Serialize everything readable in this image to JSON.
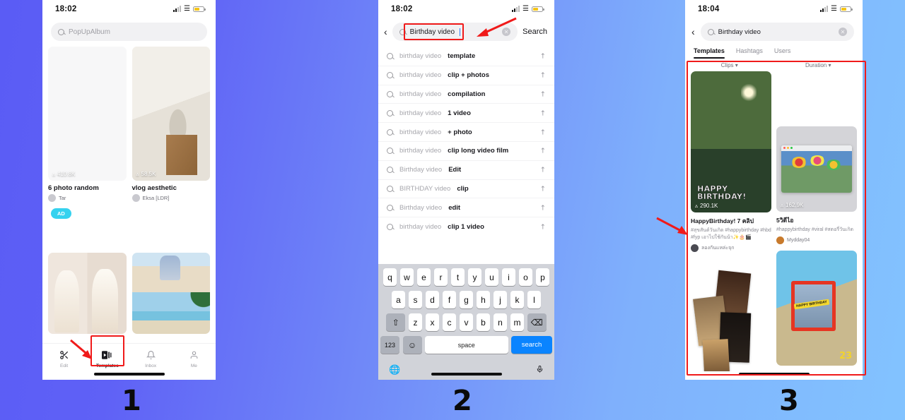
{
  "background": {
    "from": "#5a5cf5",
    "to": "#82c3ff"
  },
  "accent_red": "#f01a1a",
  "steps": {
    "one": "1",
    "two": "2",
    "three": "3"
  },
  "panel1": {
    "status": {
      "time": "18:02"
    },
    "search": {
      "placeholder": "PopUpAlbum"
    },
    "cards": [
      {
        "title": "6 photo random",
        "user": "Tar",
        "plays": "410.8K"
      },
      {
        "title": "vlog aesthetic",
        "user": "Eksa [LDR]",
        "plays": "58.5K"
      }
    ],
    "ad_label": "AD",
    "tabs": [
      {
        "label": "Edit",
        "icon": "scissors-icon",
        "active": false
      },
      {
        "label": "Templates",
        "icon": "templates-icon",
        "active": true
      },
      {
        "label": "Inbox",
        "icon": "bell-icon",
        "active": false
      },
      {
        "label": "Me",
        "icon": "person-icon",
        "active": false
      }
    ]
  },
  "panel2": {
    "status": {
      "time": "18:02"
    },
    "search": {
      "value": "Birthday video",
      "button": "Search",
      "clear_icon": "clear-circle-icon",
      "back_icon": "back-chevron-icon"
    },
    "suggestions": [
      {
        "prefix": "birthday video ",
        "bold": "template"
      },
      {
        "prefix": "birthday video ",
        "bold": "clip + photos"
      },
      {
        "prefix": "birthday video ",
        "bold": "compilation"
      },
      {
        "prefix": "birthday video ",
        "bold": "1 video"
      },
      {
        "prefix": "birthday video ",
        "bold": "+ photo"
      },
      {
        "prefix": "birthday video ",
        "bold": "clip long video film"
      },
      {
        "prefix": "Birthday video ",
        "bold": "Edit"
      },
      {
        "prefix": "BIRTHDAY video ",
        "bold": "clip"
      },
      {
        "prefix": "Birthday video ",
        "bold": "edit"
      },
      {
        "prefix": "birthday video ",
        "bold": "clip 1 video"
      }
    ],
    "keyboard": {
      "row1": [
        "q",
        "w",
        "e",
        "r",
        "t",
        "y",
        "u",
        "i",
        "o",
        "p"
      ],
      "row2": [
        "a",
        "s",
        "d",
        "f",
        "g",
        "h",
        "j",
        "k",
        "l"
      ],
      "row3": [
        "z",
        "x",
        "c",
        "v",
        "b",
        "n",
        "m"
      ],
      "shift": "⇧",
      "backspace": "⌫",
      "numbers": "123",
      "emoji": "☺",
      "space": "space",
      "go": "search",
      "globe": "🌐",
      "mic": "mic-icon"
    }
  },
  "panel3": {
    "status": {
      "time": "18:04"
    },
    "search": {
      "value": "Birthday video",
      "clear_icon": "clear-circle-icon",
      "back_icon": "back-chevron-icon"
    },
    "tabs": [
      {
        "label": "Templates",
        "active": true
      },
      {
        "label": "Hashtags",
        "active": false
      },
      {
        "label": "Users",
        "active": false
      }
    ],
    "filters": [
      {
        "label": "Clips",
        "icon": "chevron-down-icon"
      },
      {
        "label": "Duration",
        "icon": "chevron-down-icon"
      }
    ],
    "templates": [
      {
        "title": "HappyBirthday! 7 คลิป",
        "tags": "#สุขสันต์วันเกิด #happybirthday #hbd #fyp เอาไปใช้กันน้า✨🎂🎬",
        "user": "ลองกันแหล่ะจุก",
        "plays": "290.1K",
        "overlay": "HAPPY BIRTHDAY!"
      },
      {
        "title": "5วิดีไอ",
        "tags": "#happybirthday #viral #สตอรี่วันเกิด",
        "user": "Mydday04",
        "plays": "162.9K",
        "overlay": ""
      },
      {
        "title": "",
        "tags": "",
        "user": "",
        "plays": "",
        "overlay": ""
      },
      {
        "title": "",
        "tags": "",
        "user": "",
        "plays": "",
        "overlay": "HAPPY BIRTHDAY",
        "badge": "23"
      }
    ]
  }
}
